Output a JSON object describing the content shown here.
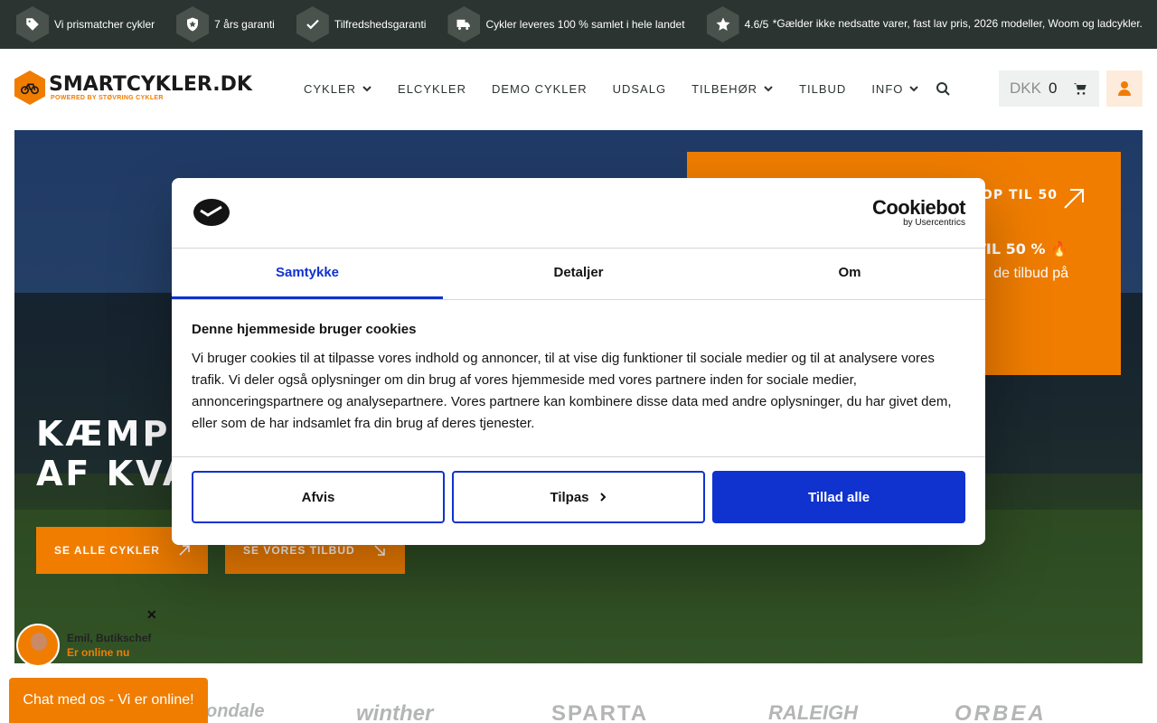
{
  "usp": {
    "items": [
      {
        "icon": "tag-icon",
        "label": "Vi prismatcher cykler"
      },
      {
        "icon": "shield-star-icon",
        "label": "7 års garanti"
      },
      {
        "icon": "check-icon",
        "label": "Tilfredshedsgaranti"
      },
      {
        "icon": "truck-icon",
        "label": "Cykler leveres 100 % samlet i hele landet"
      },
      {
        "icon": "star-icon",
        "label": "4.6/5"
      }
    ],
    "note": "*Gælder ikke nedsatte varer, fast lav pris, 2026 modeller, Woom og ladcykler."
  },
  "header": {
    "logo_main": "SMARTCYKLER.DK",
    "logo_sub": "POWERED BY STØVRING CYKLER",
    "nav": [
      "CYKLER",
      "ELCYKLER",
      "DEMO CYKLER",
      "UDSALG",
      "TILBEHØR",
      "TILBUD",
      "INFO"
    ],
    "currency": "DKK",
    "cart_count": "0"
  },
  "hero": {
    "title_line1": "KÆMPE",
    "title_line2": "AF KVA",
    "btn_all": "SE ALLE CYKLER",
    "btn_offers": "SE VORES TILBUD",
    "promo_line1": "R OP TIL 50",
    "promo_line2": "TIL 50 % 🔥",
    "promo_line3": "de tilbud på"
  },
  "chat": {
    "agent_name": "Emil, Butikschef",
    "agent_status": "Er online nu",
    "close": "✕",
    "button": "Chat med os - Vi er online!"
  },
  "brands": [
    "ondale",
    "winther",
    "SPARTA",
    "RALEIGH",
    "ORBEA"
  ],
  "cookie": {
    "brand": "Cookiebot",
    "brand_sub": "by Usercentrics",
    "tabs": [
      "Samtykke",
      "Detaljer",
      "Om"
    ],
    "heading": "Denne hjemmeside bruger cookies",
    "text": "Vi bruger cookies til at tilpasse vores indhold og annoncer, til at vise dig funktioner til sociale medier og til at analysere vores trafik. Vi deler også oplysninger om din brug af vores hjemmeside med vores partnere inden for sociale medier, annonceringspartnere og analysepartnere. Vores partnere kan kombinere disse data med andre oplysninger, du har givet dem, eller som de har indsamlet fra din brug af deres tjenester.",
    "btn_deny": "Afvis",
    "btn_customize": "Tilpas",
    "btn_allow": "Tillad alle"
  },
  "colors": {
    "brand_orange": "#f07d00",
    "top_bar": "#2b3430",
    "cookie_blue": "#1032cf"
  }
}
